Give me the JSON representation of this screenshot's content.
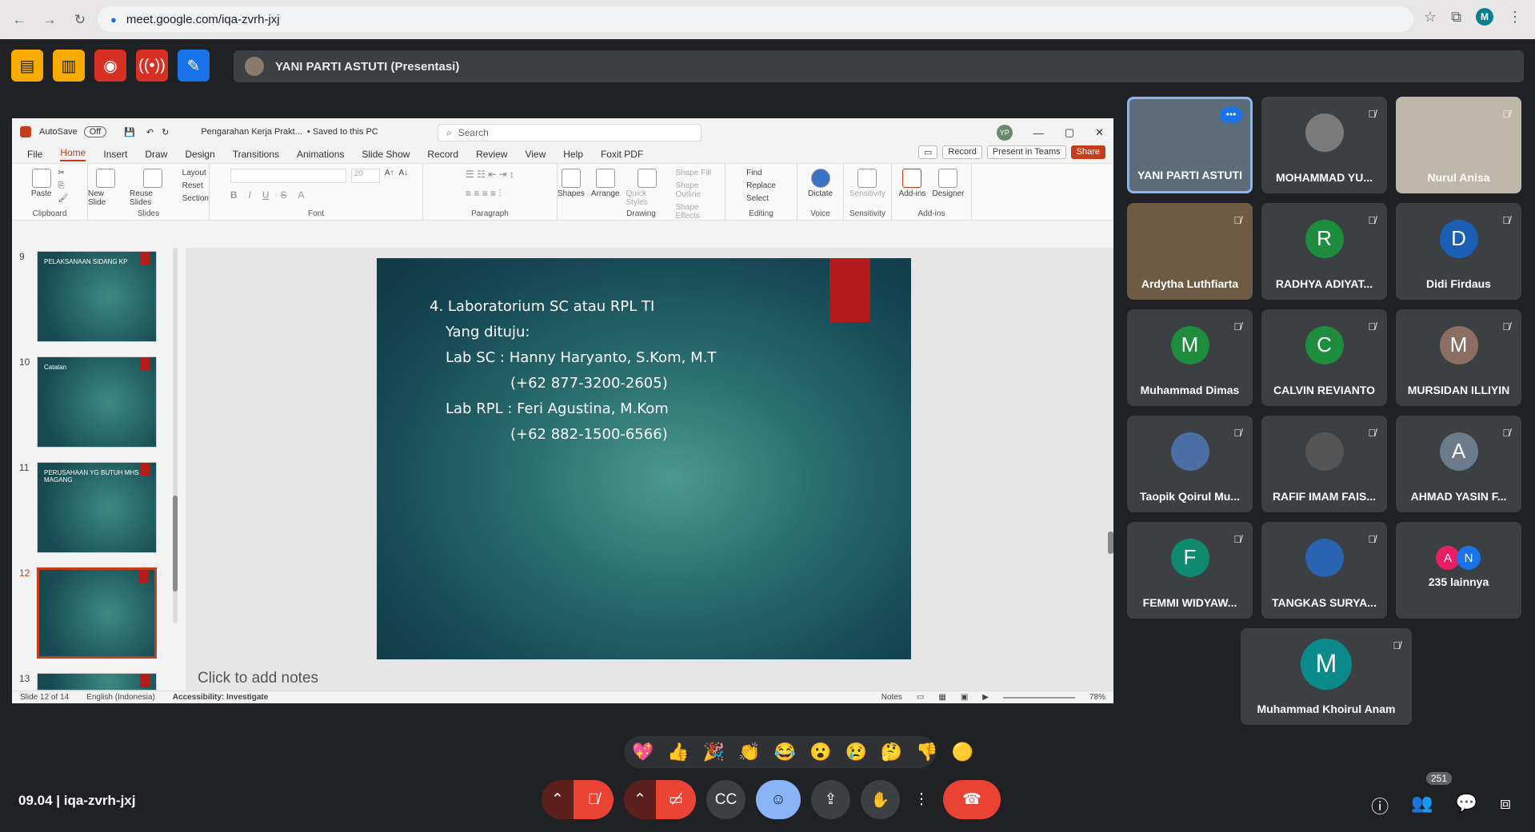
{
  "browser": {
    "url": "meet.google.com/iqa-zvrh-jxj",
    "profile_initial": "M"
  },
  "presenter_bar": {
    "label": "YANI PARTI ASTUTI (Presentasi)"
  },
  "ppt": {
    "autosave_label": "AutoSave",
    "autosave_state": "Off",
    "doc_title": "Pengarahan Kerja Prakt...",
    "save_status": "• Saved to this PC",
    "search_placeholder": "Search",
    "user_initials": "YP",
    "menu": [
      "File",
      "Home",
      "Insert",
      "Draw",
      "Design",
      "Transitions",
      "Animations",
      "Slide Show",
      "Record",
      "Review",
      "View",
      "Help",
      "Foxit PDF"
    ],
    "menu_right": {
      "record": "Record",
      "present": "Present in Teams",
      "share": "Share"
    },
    "ribbon_groups": {
      "clipboard": {
        "name": "Clipboard",
        "paste": "Paste"
      },
      "slides": {
        "name": "Slides",
        "new_slide": "New Slide",
        "reuse": "Reuse Slides",
        "layout": "Layout",
        "reset": "Reset",
        "section": "Section"
      },
      "font": {
        "name": "Font",
        "size": "20"
      },
      "paragraph": {
        "name": "Paragraph"
      },
      "drawing": {
        "name": "Drawing",
        "shapes": "Shapes",
        "arrange": "Arrange",
        "quick_styles": "Quick Styles",
        "fill": "Shape Fill",
        "outline": "Shape Outline",
        "effects": "Shape Effects"
      },
      "editing": {
        "name": "Editing",
        "find": "Find",
        "replace": "Replace",
        "select": "Select"
      },
      "voice": {
        "name": "Voice",
        "dictate": "Dictate"
      },
      "sensitivity": {
        "name": "Sensitivity",
        "label": "Sensitivity"
      },
      "addins": {
        "name": "Add-ins",
        "label": "Add-ins",
        "designer": "Designer"
      }
    },
    "thumbnails": [
      {
        "num": "9",
        "title": "PELAKSANAAN SIDANG KP"
      },
      {
        "num": "10",
        "title": "Catatan"
      },
      {
        "num": "11",
        "title": "PERUSAHAAN YG BUTUH MHS MAGANG"
      },
      {
        "num": "12",
        "title": ""
      },
      {
        "num": "13",
        "title": ""
      }
    ],
    "slide_lines": [
      "4. Laboratorium SC atau RPL TI",
      "Yang dituju:",
      "Lab SC : Hanny Haryanto, S.Kom, M.T",
      "(+62 877-3200-2605)",
      "Lab RPL : Feri Agustina, M.Kom",
      "(+62 882-1500-6566)"
    ],
    "notes_placeholder": "Click to add notes",
    "status": {
      "slide": "Slide 12 of 14",
      "language": "English (Indonesia)",
      "accessibility": "Accessibility: Investigate",
      "notes": "Notes",
      "zoom": "78%"
    }
  },
  "participants": [
    {
      "name": "YANI PARTI ASTUTI",
      "initial": "",
      "color": "#5b6c7a"
    },
    {
      "name": "MOHAMMAD YU...",
      "initial": "",
      "color": "#7a7a7a"
    },
    {
      "name": "Nurul Anisa",
      "initial": "",
      "color": "#bfb7a8"
    },
    {
      "name": "Ardytha Luthfiarta",
      "initial": "",
      "color": "#6d5b43"
    },
    {
      "name": "RADHYA ADIYAT...",
      "initial": "R",
      "color": "#1e8e3e"
    },
    {
      "name": "Didi Firdaus",
      "initial": "D",
      "color": "#1a5fb4"
    },
    {
      "name": "Muhammad Dimas",
      "initial": "M",
      "color": "#1e8e3e"
    },
    {
      "name": "CALVIN REVIANTO",
      "initial": "C",
      "color": "#1e8e3e"
    },
    {
      "name": "MURSIDAN ILLIYIN",
      "initial": "M",
      "color": "#8d6e63"
    },
    {
      "name": "Taopik Qoirul Mu...",
      "initial": "",
      "color": "#4a6fa5"
    },
    {
      "name": "RAFIF IMAM FAIS...",
      "initial": "",
      "color": "#555"
    },
    {
      "name": "AHMAD YASIN F...",
      "initial": "A",
      "color": "#6b7d8c"
    },
    {
      "name": "FEMMI WIDYAW...",
      "initial": "F",
      "color": "#0f8a6e"
    },
    {
      "name": "TANGKAS SURYA...",
      "initial": "",
      "color": "#2a64b0"
    },
    {
      "name": "235 lainnya",
      "initial": "",
      "color": ""
    },
    {
      "name": "Muhammad Khoirul Anam",
      "initial": "M",
      "color": "#0b8a8c"
    }
  ],
  "others_avatars": [
    "A",
    "N"
  ],
  "reactions": [
    "💖",
    "👍",
    "🎉",
    "👏",
    "😂",
    "😮",
    "😢",
    "🤔",
    "👎",
    "🟡"
  ],
  "footer": {
    "time_code": "09.04  |  iqa-zvrh-jxj",
    "participant_count": "251"
  }
}
